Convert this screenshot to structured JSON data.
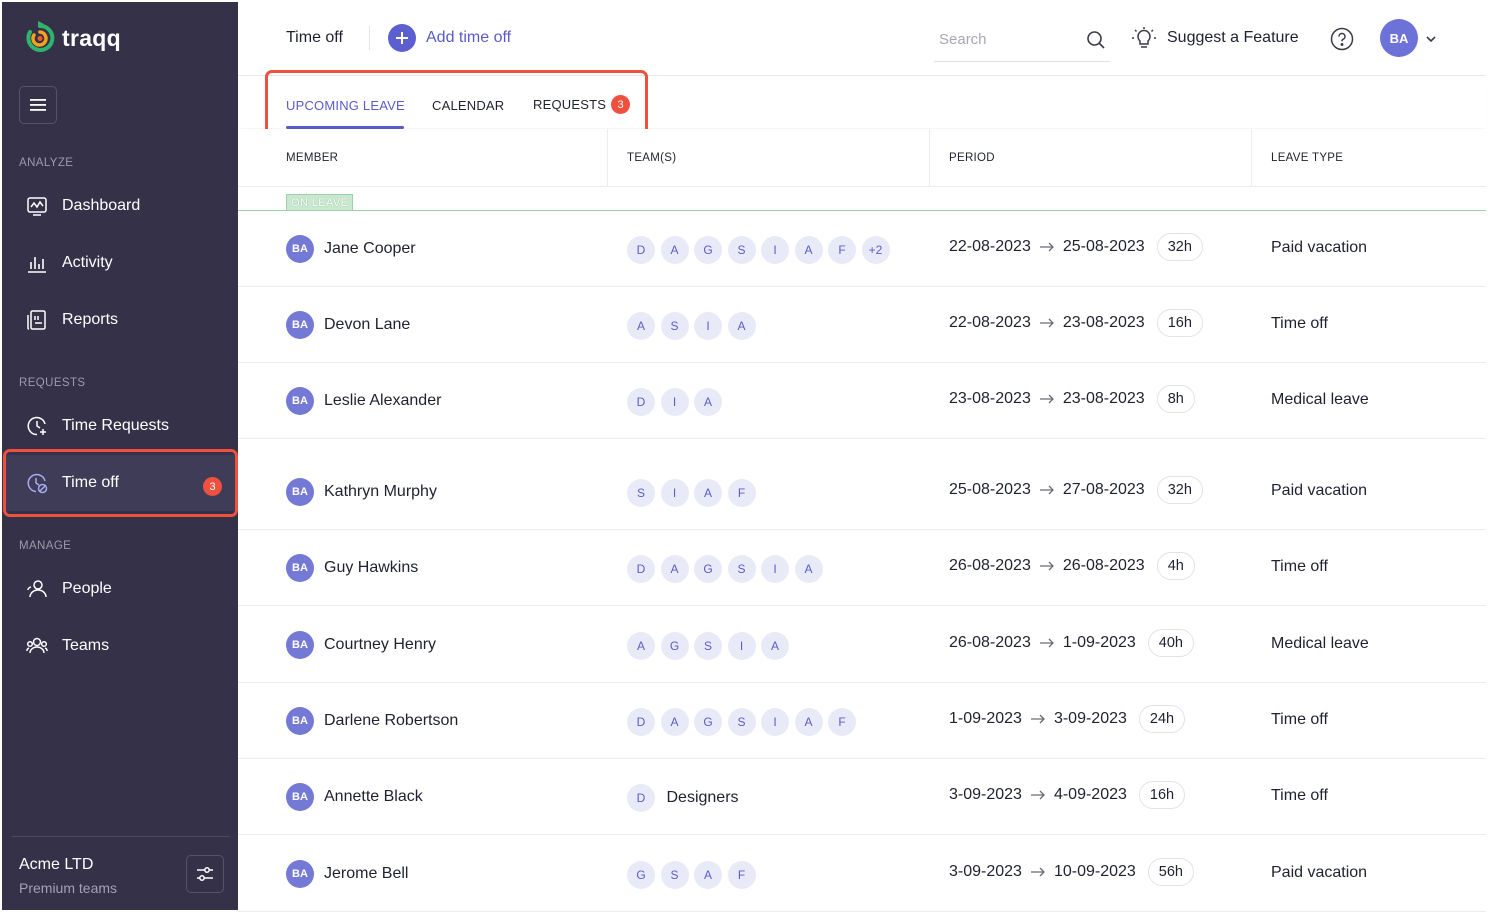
{
  "app": {
    "name": "traqq"
  },
  "sidebar": {
    "sections": [
      {
        "label": "ANALYZE",
        "items": [
          {
            "label": "Dashboard",
            "icon": "dashboard-icon"
          },
          {
            "label": "Activity",
            "icon": "activity-icon"
          },
          {
            "label": "Reports",
            "icon": "reports-icon"
          }
        ]
      },
      {
        "label": "REQUESTS",
        "items": [
          {
            "label": "Time Requests",
            "icon": "time-requests-icon"
          },
          {
            "label": "Time off",
            "icon": "time-off-icon",
            "badge": "3",
            "active": true
          }
        ]
      },
      {
        "label": "MANAGE",
        "items": [
          {
            "label": "People",
            "icon": "people-icon"
          },
          {
            "label": "Teams",
            "icon": "teams-icon"
          }
        ]
      }
    ],
    "org": {
      "name": "Acme LTD",
      "plan": "Premium teams"
    }
  },
  "header": {
    "title": "Time off",
    "add_label": "Add time off",
    "search_placeholder": "Search",
    "suggest_label": "Suggest a Feature",
    "user_initials": "BA"
  },
  "tabs": [
    {
      "label": "UPCOMING LEAVE",
      "active": true
    },
    {
      "label": "CALENDAR"
    },
    {
      "label": "REQUESTS",
      "badge": "3"
    }
  ],
  "table": {
    "columns": [
      "MEMBER",
      "TEAM(S)",
      "PERIOD",
      "LEAVE TYPE"
    ],
    "on_leave_label": "ON LEAVE",
    "on_leave_rows": [
      {
        "initials": "BA",
        "name": "Jane Cooper",
        "teams": [
          "D",
          "A",
          "G",
          "S",
          "I",
          "A",
          "F",
          "+2"
        ],
        "start": "22-08-2023",
        "end": "25-08-2023",
        "hours": "32h",
        "type": "Paid vacation"
      },
      {
        "initials": "BA",
        "name": "Devon Lane",
        "teams": [
          "A",
          "S",
          "I",
          "A"
        ],
        "start": "22-08-2023",
        "end": "23-08-2023",
        "hours": "16h",
        "type": "Time off"
      },
      {
        "initials": "BA",
        "name": "Leslie Alexander",
        "teams": [
          "D",
          "I",
          "A"
        ],
        "start": "23-08-2023",
        "end": "23-08-2023",
        "hours": "8h",
        "type": "Medical leave"
      }
    ],
    "upcoming_rows": [
      {
        "initials": "BA",
        "name": "Kathryn Murphy",
        "teams": [
          "S",
          "I",
          "A",
          "F"
        ],
        "start": "25-08-2023",
        "end": "27-08-2023",
        "hours": "32h",
        "type": "Paid vacation"
      },
      {
        "initials": "BA",
        "name": "Guy Hawkins",
        "teams": [
          "D",
          "A",
          "G",
          "S",
          "I",
          "A"
        ],
        "start": "26-08-2023",
        "end": "26-08-2023",
        "hours": "4h",
        "type": "Time off"
      },
      {
        "initials": "BA",
        "name": "Courtney Henry",
        "teams": [
          "A",
          "G",
          "S",
          "I",
          "A"
        ],
        "start": "26-08-2023",
        "end": "1-09-2023",
        "hours": "40h",
        "type": "Medical leave"
      },
      {
        "initials": "BA",
        "name": "Darlene Robertson",
        "teams": [
          "D",
          "A",
          "G",
          "S",
          "I",
          "A",
          "F"
        ],
        "start": "1-09-2023",
        "end": "3-09-2023",
        "hours": "24h",
        "type": "Time off"
      },
      {
        "initials": "BA",
        "name": "Annette Black",
        "teams": [
          "D"
        ],
        "team_name": "Designers",
        "start": "3-09-2023",
        "end": "4-09-2023",
        "hours": "16h",
        "type": "Time off"
      },
      {
        "initials": "BA",
        "name": "Jerome Bell",
        "teams": [
          "G",
          "S",
          "A",
          "F"
        ],
        "start": "3-09-2023",
        "end": "10-09-2023",
        "hours": "56h",
        "type": "Paid vacation"
      }
    ]
  },
  "colors": {
    "sidebar_bg": "#343148",
    "accent": "#5a5bc8",
    "badge": "#f0503e",
    "on_leave": "#9fcfa9"
  }
}
